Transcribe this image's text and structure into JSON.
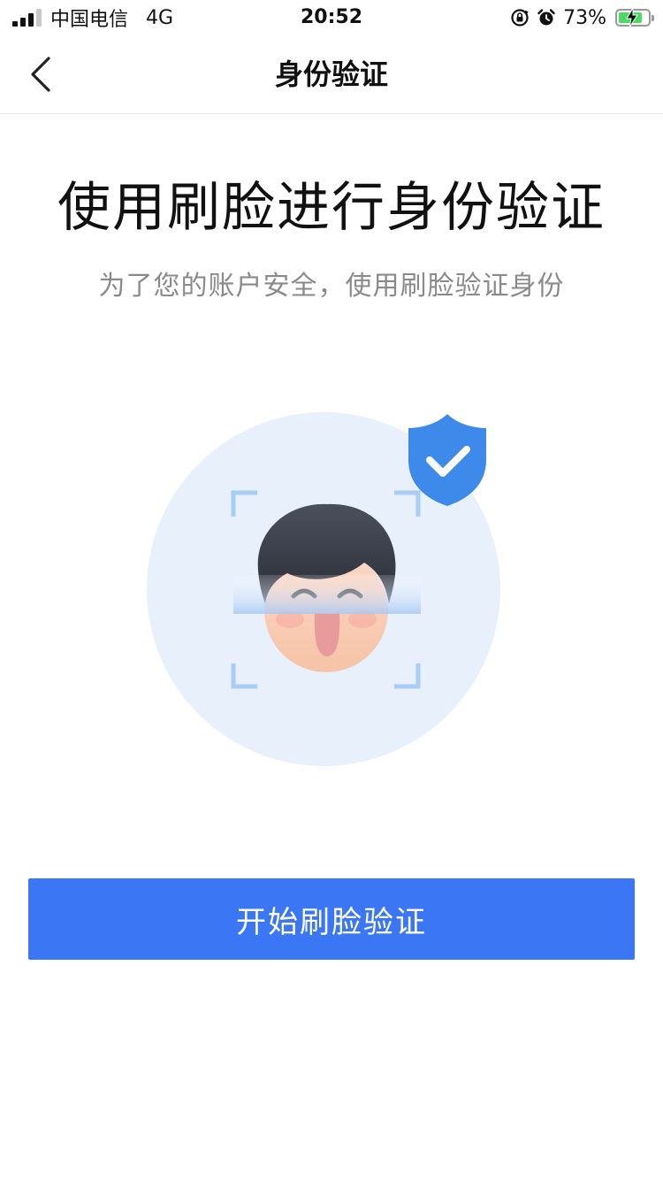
{
  "status_bar": {
    "carrier": "中国电信",
    "network": "4G",
    "time": "20:52",
    "battery_percent": "73%",
    "battery_level": 0.73,
    "icons": [
      "signal-icon",
      "orientation-lock-icon",
      "alarm-icon",
      "battery-charging-icon"
    ]
  },
  "nav": {
    "title": "身份验证",
    "back_icon": "chevron-left-icon"
  },
  "main": {
    "heading": "使用刷脸进行身份验证",
    "subheading": "为了您的账户安全，使用刷脸验证身份",
    "illustration_icons": [
      "face-scan-icon",
      "shield-check-icon"
    ],
    "primary_button_label": "开始刷脸验证"
  },
  "colors": {
    "accent": "#3b77f5",
    "shield": "#3e8aeb",
    "circle_bg": "#e8f0fb",
    "subtext": "#8a8a8a"
  }
}
